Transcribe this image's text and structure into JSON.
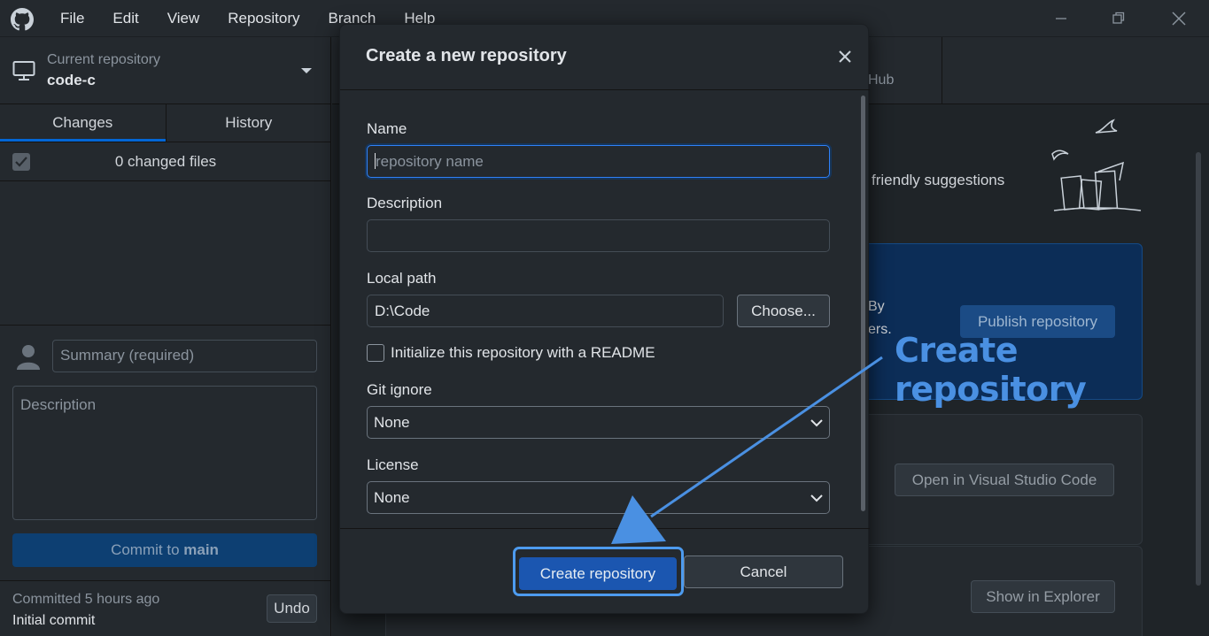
{
  "menubar": {
    "items": [
      "File",
      "Edit",
      "View",
      "Repository",
      "Branch",
      "Help"
    ]
  },
  "sidebar": {
    "current_repo_label": "Current repository",
    "current_repo_name": "code-c",
    "tabs": [
      {
        "label": "Changes",
        "active": true
      },
      {
        "label": "History",
        "active": false
      }
    ],
    "changed_files": "0 changed files",
    "summary_placeholder": "Summary (required)",
    "description_placeholder": "Description",
    "commit_prefix": "Commit to ",
    "commit_branch": "main",
    "last_commit_time": "Committed 5 hours ago",
    "last_commit_message": "Initial commit",
    "undo_label": "Undo"
  },
  "main": {
    "hub_tab_fragment": "Hub",
    "friendly_text": "friendly suggestions",
    "publish_frag1": "By",
    "publish_frag2": "ers.",
    "publish_button": "Publish repository",
    "open_vscode_button": "Open in Visual Studio Code",
    "show_explorer_button": "Show in Explorer"
  },
  "dialog": {
    "title": "Create a new repository",
    "name_label": "Name",
    "name_placeholder": "repository name",
    "description_label": "Description",
    "local_path_label": "Local path",
    "local_path_value": "D:\\Code",
    "choose_button": "Choose...",
    "readme_label": "Initialize this repository with a README",
    "gitignore_label": "Git ignore",
    "gitignore_value": "None",
    "license_label": "License",
    "license_value": "None",
    "create_button": "Create repository",
    "cancel_button": "Cancel"
  },
  "annotation": {
    "text": "Create repository",
    "color": "#4a90e2"
  },
  "colors": {
    "accent": "#1f6feb",
    "background": "#24292e"
  }
}
